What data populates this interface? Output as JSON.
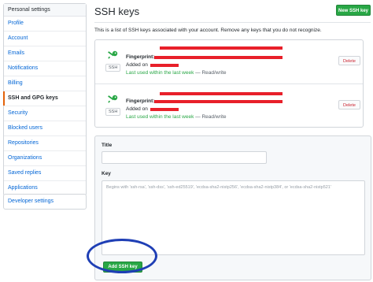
{
  "sidebar": {
    "header": "Personal settings",
    "items": [
      {
        "label": "Profile"
      },
      {
        "label": "Account"
      },
      {
        "label": "Emails"
      },
      {
        "label": "Notifications"
      },
      {
        "label": "Billing"
      },
      {
        "label": "SSH and GPG keys",
        "active": true
      },
      {
        "label": "Security"
      },
      {
        "label": "Blocked users"
      },
      {
        "label": "Repositories"
      },
      {
        "label": "Organizations"
      },
      {
        "label": "Saved replies"
      },
      {
        "label": "Applications"
      }
    ],
    "developer_settings": "Developer settings"
  },
  "header": {
    "title": "SSH keys",
    "new_key_button": "New SSH key"
  },
  "intro_text": "This is a list of SSH keys associated with your account. Remove any keys that you do not recognize.",
  "keys": [
    {
      "badge": "SSH",
      "fingerprint_label": "Fingerprint:",
      "added_label": "Added on",
      "last_used": "Last used within the last week",
      "access": " — Read/write",
      "delete_label": "Delete"
    },
    {
      "badge": "SSH",
      "fingerprint_label": "Fingerprint:",
      "added_label": "Added on",
      "last_used": "Last used within the last week",
      "access": " — Read/write",
      "delete_label": "Delete"
    }
  ],
  "form": {
    "title_label": "Title",
    "key_label": "Key",
    "key_placeholder": "Begins with 'ssh-rsa', 'ssh-dss', 'ssh-ed25519', 'ecdsa-sha2-nistp256', 'ecdsa-sha2-nistp384', or 'ecdsa-sha2-nistp521'",
    "add_button": "Add SSH key"
  },
  "colors": {
    "accent_green": "#28a745",
    "link_blue": "#0366d6",
    "redaction": "#e8202a",
    "annotation_circle": "#1f3fb5"
  }
}
